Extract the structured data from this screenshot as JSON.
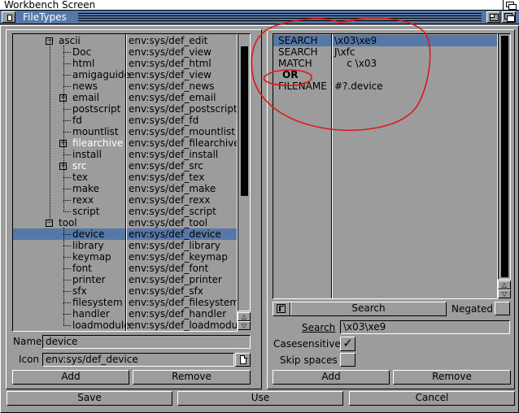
{
  "screen": {
    "title": "Workbench Screen"
  },
  "window": {
    "title": "FileTypes"
  },
  "tree": {
    "rows": [
      {
        "name": "ascii",
        "value": "env:sys/def_edit",
        "expander": "minus",
        "white": false,
        "selected": false,
        "depth": 0
      },
      {
        "name": "Doc",
        "value": "env:sys/def_view",
        "expander": "",
        "white": false,
        "selected": false,
        "depth": 1
      },
      {
        "name": "html",
        "value": "env:sys/def_html",
        "expander": "",
        "white": false,
        "selected": false,
        "depth": 1
      },
      {
        "name": "amigaguide",
        "value": "env:sys/def_view",
        "expander": "",
        "white": false,
        "selected": false,
        "depth": 1
      },
      {
        "name": "news",
        "value": "env:sys/def_news",
        "expander": "",
        "white": false,
        "selected": false,
        "depth": 1
      },
      {
        "name": "email",
        "value": "env:sys/def_email",
        "expander": "plus",
        "white": false,
        "selected": false,
        "depth": 1
      },
      {
        "name": "postscript",
        "value": "env:sys/def_postscript",
        "expander": "",
        "white": false,
        "selected": false,
        "depth": 1
      },
      {
        "name": "fd",
        "value": "env:sys/def_fd",
        "expander": "",
        "white": false,
        "selected": false,
        "depth": 1
      },
      {
        "name": "mountlist",
        "value": "env:sys/def_mountlist",
        "expander": "",
        "white": false,
        "selected": false,
        "depth": 1
      },
      {
        "name": "filearchive",
        "value": "env:sys/def_filearchive",
        "expander": "plus",
        "white": true,
        "selected": false,
        "depth": 1
      },
      {
        "name": "install",
        "value": "env:sys/def_install",
        "expander": "",
        "white": false,
        "selected": false,
        "depth": 1
      },
      {
        "name": "src",
        "value": "env:sys/def_src",
        "expander": "plus",
        "white": true,
        "selected": false,
        "depth": 1
      },
      {
        "name": "tex",
        "value": "env:sys/def_tex",
        "expander": "",
        "white": false,
        "selected": false,
        "depth": 1
      },
      {
        "name": "make",
        "value": "env:sys/def_make",
        "expander": "",
        "white": false,
        "selected": false,
        "depth": 1
      },
      {
        "name": "rexx",
        "value": "env:sys/def_rexx",
        "expander": "",
        "white": false,
        "selected": false,
        "depth": 1
      },
      {
        "name": "script",
        "value": "env:sys/def_script",
        "expander": "",
        "white": false,
        "selected": false,
        "depth": 1
      },
      {
        "name": "tool",
        "value": "env:sys/def_tool",
        "expander": "minus",
        "white": false,
        "selected": false,
        "depth": 0
      },
      {
        "name": "device",
        "value": "env:sys/def_device",
        "expander": "",
        "white": false,
        "selected": true,
        "depth": 1
      },
      {
        "name": "library",
        "value": "env:sys/def_library",
        "expander": "",
        "white": false,
        "selected": false,
        "depth": 1
      },
      {
        "name": "keymap",
        "value": "env:sys/def_keymap",
        "expander": "",
        "white": false,
        "selected": false,
        "depth": 1
      },
      {
        "name": "font",
        "value": "env:sys/def_font",
        "expander": "",
        "white": false,
        "selected": false,
        "depth": 1
      },
      {
        "name": "printer",
        "value": "env:sys/def_printer",
        "expander": "",
        "white": false,
        "selected": false,
        "depth": 1
      },
      {
        "name": "sfx",
        "value": "env:sys/def_sfx",
        "expander": "",
        "white": false,
        "selected": false,
        "depth": 1
      },
      {
        "name": "filesystem",
        "value": "env:sys/def_filesystem",
        "expander": "",
        "white": false,
        "selected": false,
        "depth": 1
      },
      {
        "name": "handler",
        "value": "env:sys/def_handler",
        "expander": "",
        "white": false,
        "selected": false,
        "depth": 1
      },
      {
        "name": "loadmodule",
        "value": "env:sys/def_loadmodul",
        "expander": "",
        "white": false,
        "selected": false,
        "depth": 1
      }
    ]
  },
  "left_form": {
    "name_label": "Name",
    "name_value": "device",
    "icon_label": "Icon",
    "icon_value": "env:sys/def_device",
    "add_label": "Add",
    "remove_label": "Remove"
  },
  "conditions": {
    "rows": [
      {
        "type": "SEARCH",
        "arg": "\\x03\\xe9",
        "selected": true,
        "bold": false
      },
      {
        "type": "SEARCH",
        "arg": "J\\xfc",
        "selected": false,
        "bold": false
      },
      {
        "type": "MATCH",
        "arg": "    c \\x03",
        "selected": false,
        "bold": false
      },
      {
        "type": "OR",
        "arg": "",
        "selected": false,
        "bold": true
      },
      {
        "type": "FILENAME",
        "arg": "#?.device",
        "selected": false,
        "bold": false
      }
    ]
  },
  "right_form": {
    "type_cycle_label": "Search",
    "negated_label": "Negated",
    "search_label": "Search",
    "search_value": "\\x03\\xe9",
    "casesensitive_label": "Casesensitive",
    "casesensitive_checked": "✓",
    "skipspaces_label": "Skip spaces",
    "add_label": "Add",
    "remove_label": "Remove"
  },
  "footer": {
    "save_label": "Save",
    "use_label": "Use",
    "cancel_label": "Cancel"
  },
  "colors": {
    "background": "#9c9c9c",
    "selection": "#5678a8",
    "annotation": "#e01818"
  }
}
